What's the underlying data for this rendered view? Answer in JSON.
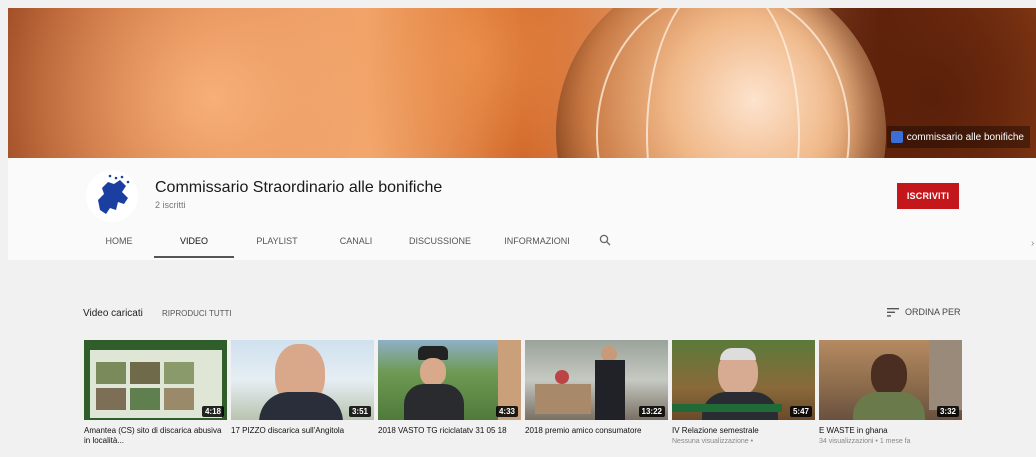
{
  "banner": {
    "link_text": "commissario alle bonifiche"
  },
  "channel": {
    "title": "Commissario Straordinario alle bonifiche",
    "subscribers": "2 iscritti",
    "subscribe_label": "ISCRIVITI"
  },
  "tabs": [
    {
      "label": "HOME",
      "active": false
    },
    {
      "label": "VIDEO",
      "active": true
    },
    {
      "label": "PLAYLIST",
      "active": false
    },
    {
      "label": "CANALI",
      "active": false
    },
    {
      "label": "DISCUSSIONE",
      "active": false
    },
    {
      "label": "INFORMAZIONI",
      "active": false
    }
  ],
  "section": {
    "title": "Video caricati",
    "play_all": "RIPRODUCI TUTTI",
    "sort_label": "ORDINA PER"
  },
  "videos": [
    {
      "title": "Amantea (CS) sito di discarica abusiva in località...",
      "duration": "4:18",
      "meta": ""
    },
    {
      "title": "17 PIZZO discarica sull'Angitola",
      "duration": "3:51",
      "meta": ""
    },
    {
      "title": "2018 VASTO TG riciclatatv 31 05 18",
      "duration": "4:33",
      "meta": ""
    },
    {
      "title": "2018 premio amico consumatore",
      "duration": "13:22",
      "meta": ""
    },
    {
      "title": "IV Relazione semestrale",
      "duration": "5:47",
      "meta": "Nessuna visualizzazione •"
    },
    {
      "title": "E WASTE in ghana",
      "duration": "3:32",
      "meta": "34 visualizzazioni • 1 mese fa"
    }
  ],
  "colors": {
    "subscribe": "#c4171c",
    "banner_accent": "#c8602a"
  }
}
